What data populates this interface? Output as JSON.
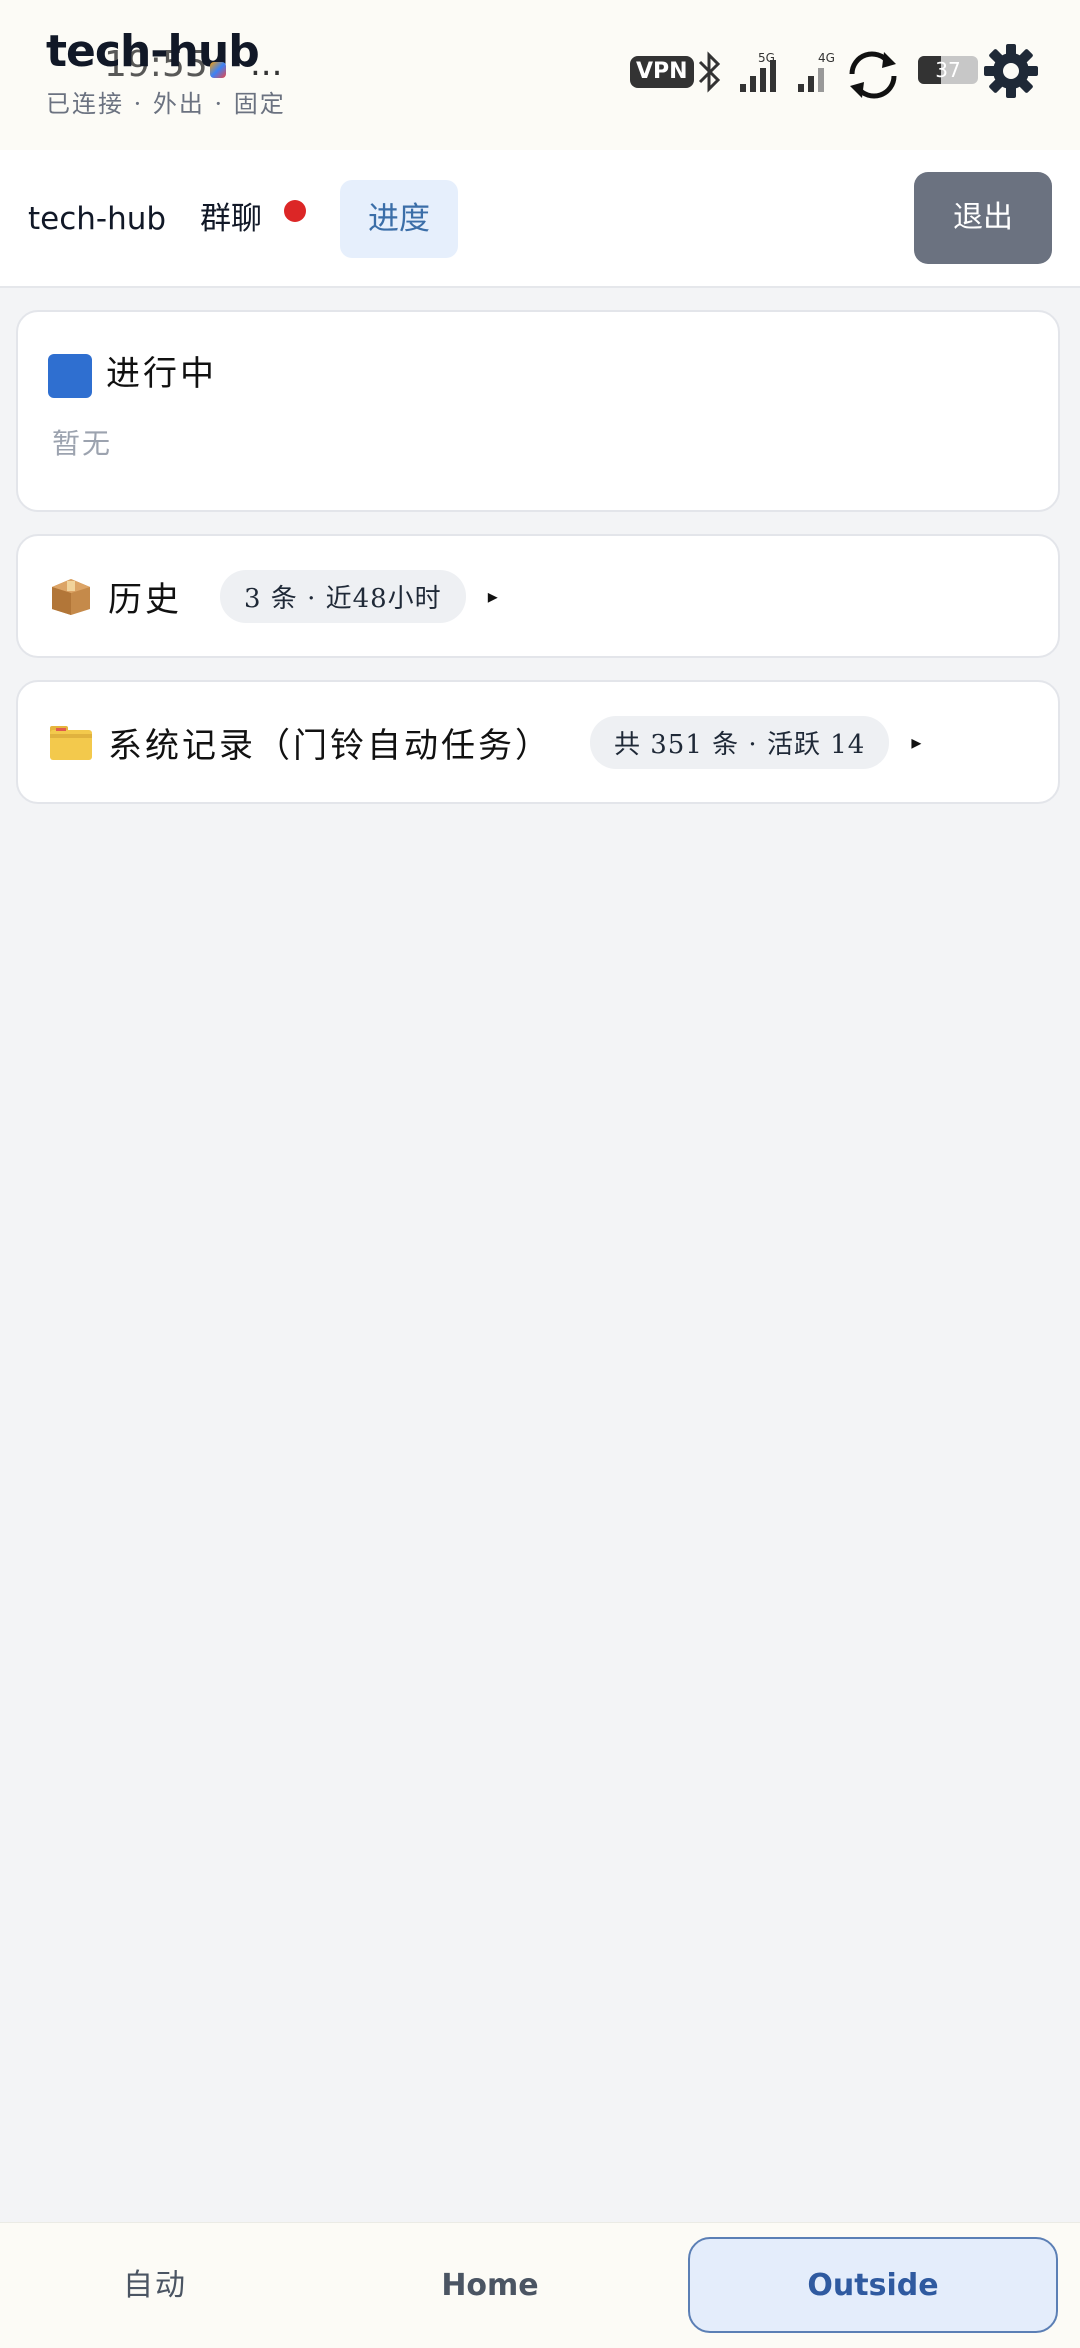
{
  "status_bar": {
    "time": "19:55",
    "more": "...",
    "vpn": "VPN",
    "net_5g": "5G",
    "net_4g": "4G",
    "battery": "37"
  },
  "header": {
    "title": "tech-hub",
    "connection_status": "已连接 · 外出 · 固定"
  },
  "tabs": {
    "home": "tech-hub",
    "chat": "群聊",
    "progress": "进度",
    "logout": "退出"
  },
  "cards": {
    "in_progress": {
      "title": "进行中",
      "empty": "暂无",
      "icon": "blue-square-icon"
    },
    "history": {
      "title": "历史",
      "badge": "3 条 · 近48小时",
      "icon": "package-icon",
      "arrow": "▸"
    },
    "system": {
      "title": "系统记录（门铃自动任务）",
      "badge": "共 351 条 · 活跃 14",
      "icon": "folder-icon",
      "arrow": "▸"
    }
  },
  "bottom_nav": {
    "auto": "自动",
    "home": "Home",
    "outside": "Outside"
  },
  "colors": {
    "accent": "#2f5aa0",
    "logout_bg": "#6b7280",
    "alert_dot": "#dc2626"
  }
}
